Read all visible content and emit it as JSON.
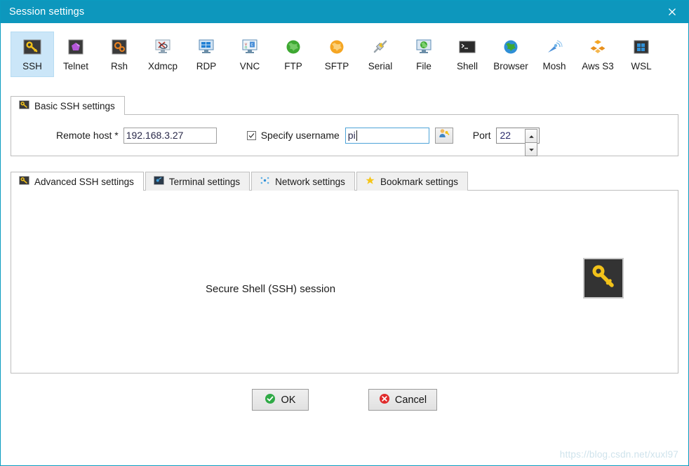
{
  "window": {
    "title": "Session settings",
    "close_label": "×",
    "accent_color": "#0d97bd",
    "selection_color": "#cbe6f8"
  },
  "protocols": [
    {
      "label": "SSH",
      "icon": "ssh-key-icon",
      "selected": true
    },
    {
      "label": "Telnet",
      "icon": "telnet-icon",
      "selected": false
    },
    {
      "label": "Rsh",
      "icon": "rsh-gears-icon",
      "selected": false
    },
    {
      "label": "Xdmcp",
      "icon": "xdmcp-icon",
      "selected": false
    },
    {
      "label": "RDP",
      "icon": "rdp-monitor-icon",
      "selected": false
    },
    {
      "label": "VNC",
      "icon": "vnc-monitor-icon",
      "selected": false
    },
    {
      "label": "FTP",
      "icon": "ftp-globe-icon",
      "selected": false
    },
    {
      "label": "SFTP",
      "icon": "sftp-globe-icon",
      "selected": false
    },
    {
      "label": "Serial",
      "icon": "serial-plug-icon",
      "selected": false
    },
    {
      "label": "File",
      "icon": "file-monitor-icon",
      "selected": false
    },
    {
      "label": "Shell",
      "icon": "shell-term-icon",
      "selected": false
    },
    {
      "label": "Browser",
      "icon": "browser-globe-icon",
      "selected": false
    },
    {
      "label": "Mosh",
      "icon": "mosh-dish-icon",
      "selected": false
    },
    {
      "label": "Aws S3",
      "icon": "aws-s3-icon",
      "selected": false
    },
    {
      "label": "WSL",
      "icon": "wsl-windows-icon",
      "selected": false
    }
  ],
  "basic": {
    "tab_label": "Basic SSH settings",
    "tab_icon": "ssh-key-icon",
    "remote_host_label": "Remote host *",
    "remote_host_value": "192.168.3.27",
    "remote_host_placeholder": "",
    "specify_username_label": "Specify username",
    "specify_username_checked": true,
    "username_value": "pi",
    "username_placeholder": "",
    "user_button_icon": "user-key-icon",
    "port_label": "Port",
    "port_value": "22",
    "spin_up_icon": "chevron-up-icon",
    "spin_down_icon": "chevron-down-icon"
  },
  "lower_tabs": [
    {
      "label": "Advanced SSH settings",
      "icon": "ssh-key-icon",
      "active": true
    },
    {
      "label": "Terminal settings",
      "icon": "terminal-icon",
      "active": false
    },
    {
      "label": "Network settings",
      "icon": "network-dots-icon",
      "active": false
    },
    {
      "label": "Bookmark settings",
      "icon": "star-icon",
      "active": false
    }
  ],
  "content": {
    "session_text": "Secure Shell (SSH) session",
    "key_icon": "ssh-key-icon"
  },
  "footer": {
    "ok_label": "OK",
    "ok_icon": "check-circle-icon",
    "cancel_label": "Cancel",
    "cancel_icon": "x-circle-icon"
  },
  "watermark": "https://blog.csdn.net/xuxl97"
}
